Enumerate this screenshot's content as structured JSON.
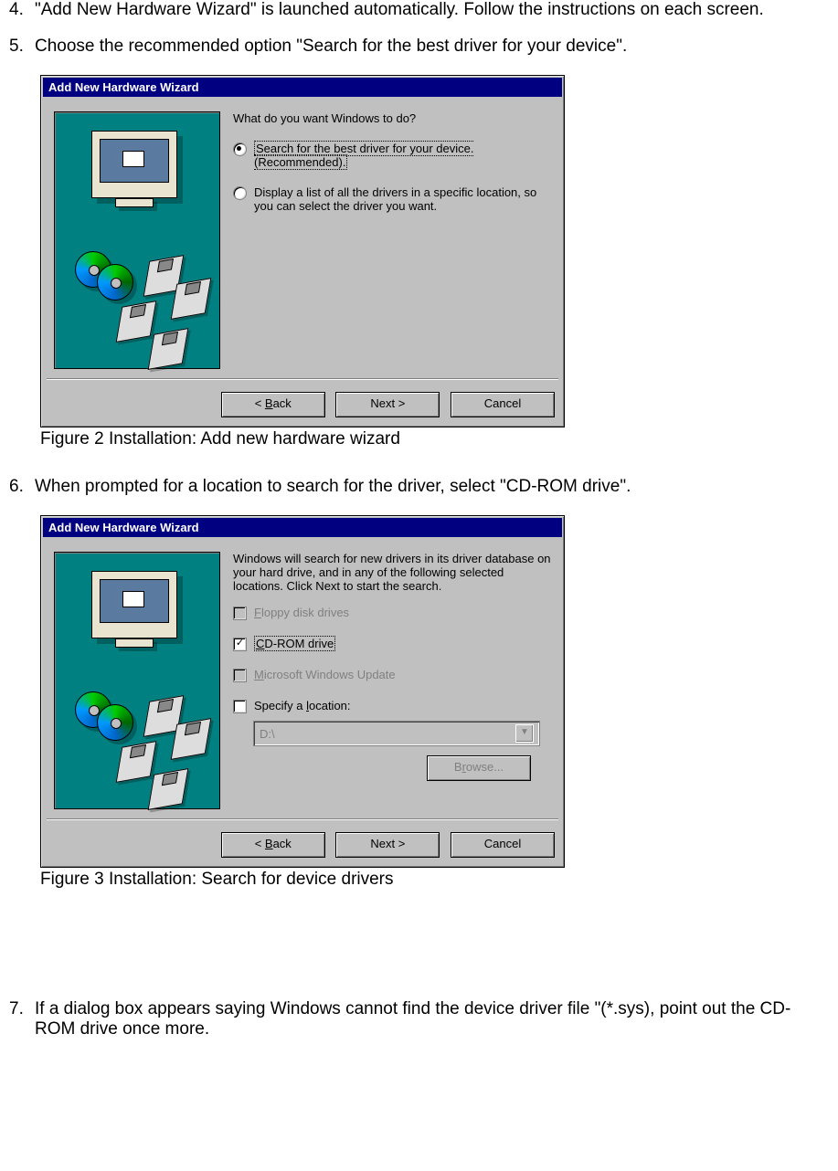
{
  "steps": {
    "s4": {
      "num": "4.",
      "text": " \"Add New Hardware Wizard\" is launched automatically. Follow the instructions on each screen."
    },
    "s5": {
      "num": "5.",
      "text": "Choose the recommended option \"Search for the best driver for your device\"."
    },
    "s6": {
      "num": "6.",
      "text": "When prompted for a location to search for the driver, select \"CD-ROM drive\"."
    },
    "s7": {
      "num": "7.",
      "text": "If a dialog box appears saying Windows cannot find the device driver file \"(*.sys), point out the CD-ROM drive once more."
    }
  },
  "captions": {
    "fig2": "Figure 2 Installation: Add new hardware wizard",
    "fig3": "Figure 3 Installation: Search for device drivers"
  },
  "wizard1": {
    "title": "Add New Hardware Wizard",
    "question": "What do you want Windows to do?",
    "opt1": "Search for the best driver for your device. (Recommended).",
    "opt2": "Display a list of all the drivers in a specific location, so you can select the driver you want."
  },
  "wizard2": {
    "title": "Add New Hardware Wizard",
    "intro": "Windows will search for new drivers in its driver database on your hard drive, and in any of the following selected locations. Click Next to start the search.",
    "floppy_u": "F",
    "floppy_rest": "loppy disk drives",
    "cdrom_u": "C",
    "cdrom_rest": "D-ROM drive",
    "msupdate_u": "M",
    "msupdate_rest": "icrosoft Windows Update",
    "spec_u": "l",
    "spec_pre": "Specify a ",
    "spec_post": "ocation:",
    "path": "D:\\",
    "browse_pre": "B",
    "browse_u": "r",
    "browse_post": "owse..."
  },
  "buttons": {
    "back_lt": "< ",
    "back_u": "B",
    "back_rest": "ack",
    "next": "Next >",
    "cancel": "Cancel"
  }
}
